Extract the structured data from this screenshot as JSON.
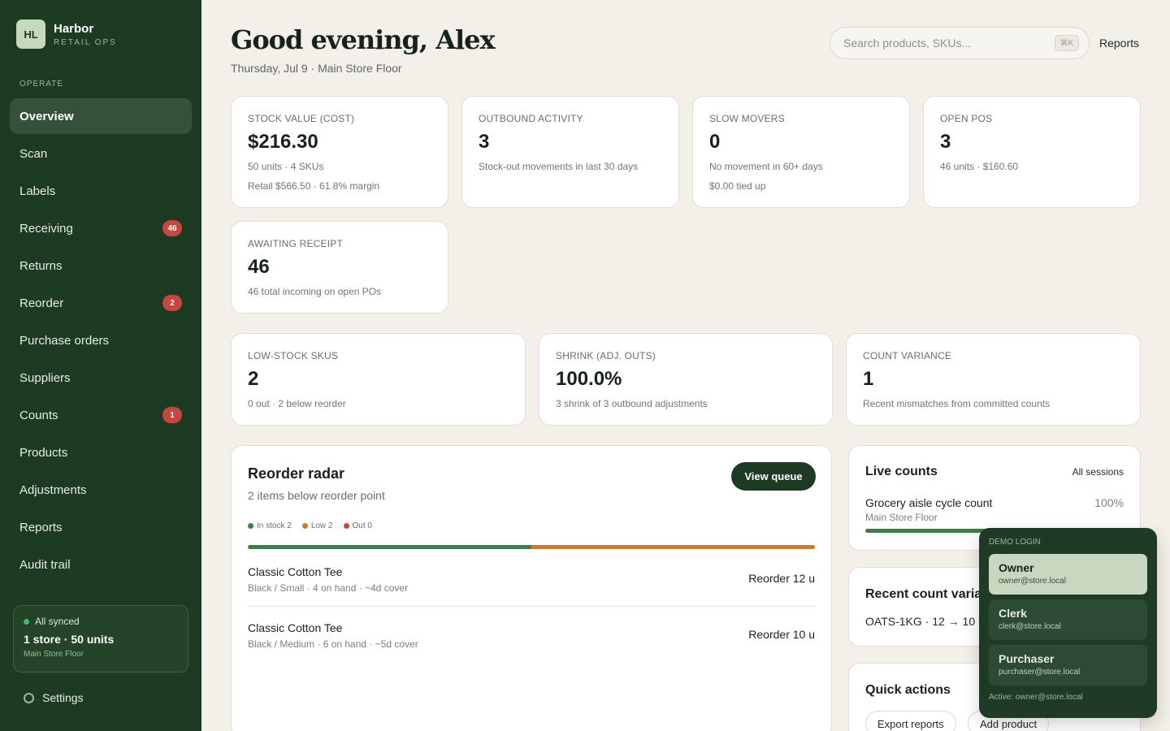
{
  "brand": {
    "logo": "HL",
    "name": "Harbor",
    "subtitle": "RETAIL OPS"
  },
  "sidebar": {
    "section": "OPERATE",
    "items": [
      {
        "label": "Overview",
        "badge": ""
      },
      {
        "label": "Scan",
        "badge": ""
      },
      {
        "label": "Labels",
        "badge": ""
      },
      {
        "label": "Receiving",
        "badge": "46"
      },
      {
        "label": "Returns",
        "badge": ""
      },
      {
        "label": "Reorder",
        "badge": "2"
      },
      {
        "label": "Purchase orders",
        "badge": ""
      },
      {
        "label": "Suppliers",
        "badge": ""
      },
      {
        "label": "Counts",
        "badge": "1"
      },
      {
        "label": "Products",
        "badge": ""
      },
      {
        "label": "Adjustments",
        "badge": ""
      },
      {
        "label": "Reports",
        "badge": ""
      },
      {
        "label": "Audit trail",
        "badge": ""
      }
    ],
    "sync": {
      "status": "All synced",
      "summary": "1 store · 50 units",
      "location": "Main Store Floor"
    },
    "settings": "Settings"
  },
  "header": {
    "greeting": "Good evening, Alex",
    "subtitle": "Thursday, Jul 9 · Main Store Floor",
    "search_placeholder": "Search products, SKUs...",
    "shortcut": "⌘K",
    "reports": "Reports"
  },
  "metrics": [
    {
      "label": "STOCK VALUE (COST)",
      "value": "$216.30",
      "line1": "50 units · 4 SKUs",
      "line2": "Retail $566.50 · 61.8% margin"
    },
    {
      "label": "OUTBOUND ACTIVITY",
      "value": "3",
      "line1": "Stock-out movements in last 30 days",
      "line2": ""
    },
    {
      "label": "SLOW MOVERS",
      "value": "0",
      "line1": "No movement in 60+ days",
      "line2": "$0.00 tied up"
    },
    {
      "label": "OPEN POS",
      "value": "3",
      "line1": "46 units · $160.60",
      "line2": ""
    },
    {
      "label": "AWAITING RECEIPT",
      "value": "46",
      "line1": "46 total incoming on open POs",
      "line2": ""
    }
  ],
  "summary": [
    {
      "label": "LOW-STOCK SKUS",
      "value": "2",
      "note": "0 out · 2 below reorder"
    },
    {
      "label": "SHRINK (ADJ. OUTS)",
      "value": "100.0%",
      "note": "3 shrink of 3 outbound adjustments"
    },
    {
      "label": "COUNT VARIANCE",
      "value": "1",
      "note": "Recent mismatches from committed counts"
    }
  ],
  "reorder": {
    "title": "Reorder radar",
    "subtitle": "2 items below reorder point",
    "button": "View queue",
    "legend": [
      {
        "label": "In stock 2",
        "count": 2,
        "color": "#3f7d4d"
      },
      {
        "label": "Low 2",
        "count": 2,
        "color": "#c97b31"
      },
      {
        "label": "Out 0",
        "count": 0,
        "color": "#c8473c"
      }
    ],
    "items": [
      {
        "name": "Classic Cotton Tee",
        "detail": "Black / Small · 4 on hand · ~4d cover",
        "action": "Reorder 12 u"
      },
      {
        "name": "Classic Cotton Tee",
        "detail": "Black / Medium · 6 on hand · ~5d cover",
        "action": "Reorder 10 u"
      }
    ]
  },
  "live_counts": {
    "title": "Live counts",
    "link": "All sessions",
    "session": {
      "name": "Grocery aisle cycle count",
      "location": "Main Store Floor",
      "percent": "100%",
      "progress": 1.0
    }
  },
  "variance": {
    "title": "Recent count variance",
    "line": "OATS-1KG · 12 → 10 (−2)"
  },
  "quick_actions": {
    "title": "Quick actions",
    "buttons": [
      "Export reports",
      "Add product"
    ]
  },
  "demo_login": {
    "label": "DEMO LOGIN",
    "options": [
      {
        "role": "Owner",
        "email": "owner@store.local"
      },
      {
        "role": "Clerk",
        "email": "clerk@store.local"
      },
      {
        "role": "Purchaser",
        "email": "purchaser@store.local"
      }
    ],
    "active": "Active: owner@store.local"
  },
  "colors": {
    "accent": "#1d3a23",
    "badge": "#c8473c",
    "success": "#3f7d4d",
    "warning": "#c97b31"
  }
}
